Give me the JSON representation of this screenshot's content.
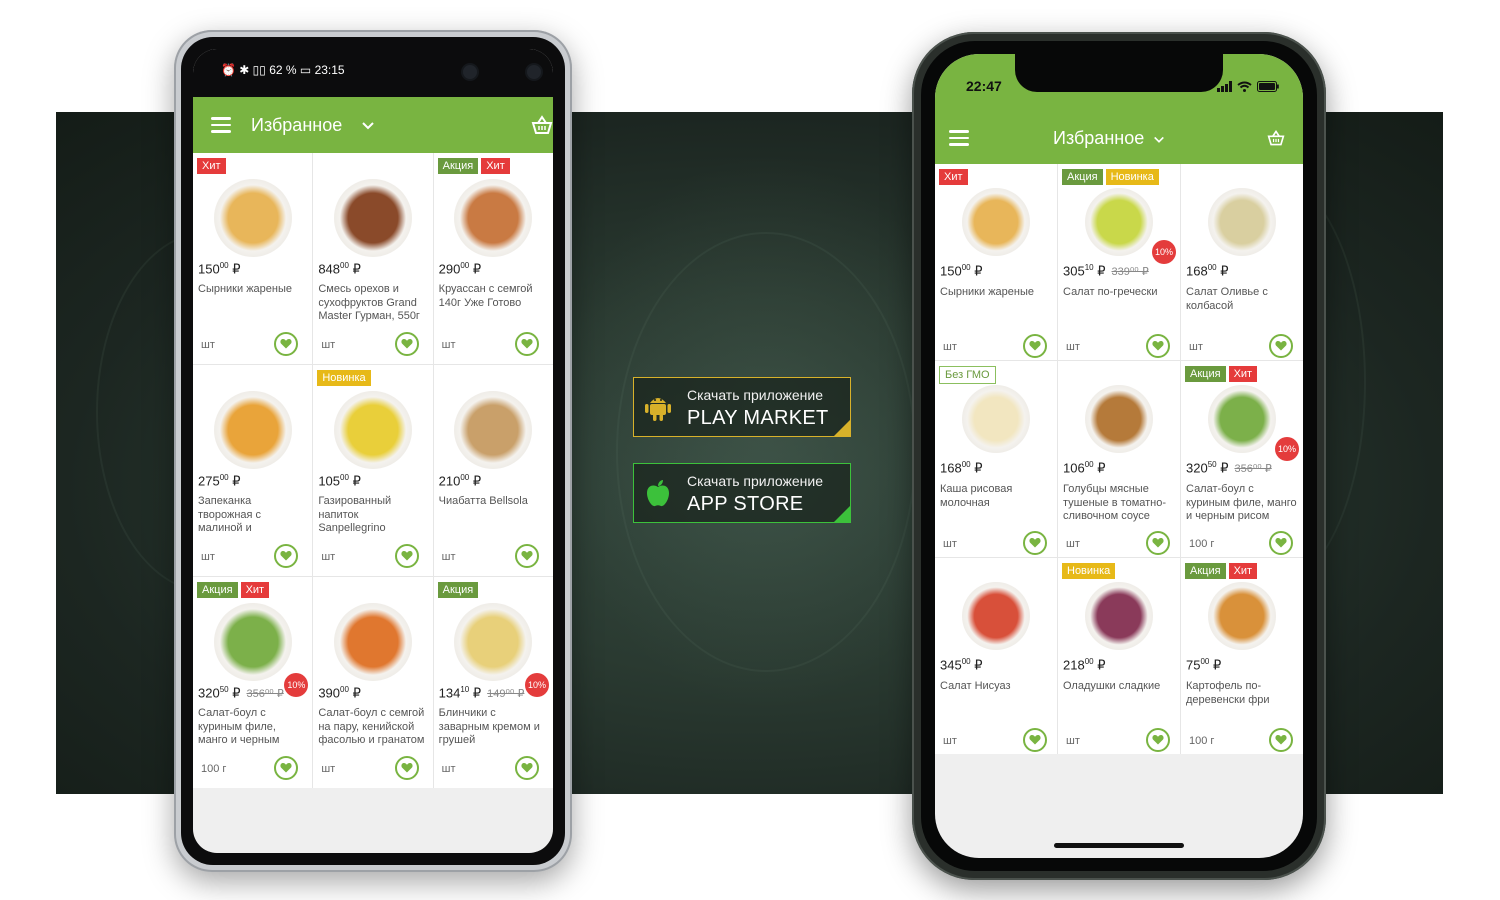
{
  "colors": {
    "brand_green": "#79b441",
    "hit_red": "#e53b3b",
    "promo_green": "#6a9a3e",
    "new_yellow": "#e7b918"
  },
  "store_buttons": {
    "play": {
      "line1": "Скачать приложение",
      "line2": "PLAY MARKET",
      "icon": "android-icon"
    },
    "app": {
      "line1": "Скачать приложение",
      "line2": "APP STORE",
      "icon": "apple-icon"
    }
  },
  "android": {
    "status": {
      "text": "62 % ",
      "time": "23:15"
    },
    "title": "Избранное",
    "products": [
      {
        "badges": [
          {
            "text": "Хит",
            "type": "hit"
          }
        ],
        "price_main": "150",
        "price_cents": "00",
        "currency": "₽",
        "name": "Сырники жареные",
        "unit": "шт",
        "color": "#e8b65a"
      },
      {
        "badges": [],
        "price_main": "848",
        "price_cents": "00",
        "currency": "₽",
        "name": "Смесь орехов и сухофруктов Grand Master Гурман, 550г",
        "unit": "шт",
        "color": "#8a4a2a"
      },
      {
        "badges": [
          {
            "text": "Акция",
            "type": "akc"
          },
          {
            "text": "Хит",
            "type": "hit"
          }
        ],
        "price_main": "290",
        "price_cents": "00",
        "currency": "₽",
        "name": "Круассан с семгой 140г Уже Готово",
        "unit": "шт",
        "color": "#c97a43"
      },
      {
        "badges": [],
        "price_main": "275",
        "price_cents": "00",
        "currency": "₽",
        "name": "Запеканка творожная с малиной и",
        "unit": "шт",
        "color": "#e9a43a"
      },
      {
        "badges": [
          {
            "text": "Новинка",
            "type": "new"
          }
        ],
        "price_main": "105",
        "price_cents": "00",
        "currency": "₽",
        "name": "Газированный напиток Sanpellegrino",
        "unit": "шт",
        "color": "#e9cf3a"
      },
      {
        "badges": [],
        "price_main": "210",
        "price_cents": "00",
        "currency": "₽",
        "name": "Чиабатта Bellsola",
        "unit": "шт",
        "color": "#c9a06a"
      },
      {
        "badges": [
          {
            "text": "Акция",
            "type": "akc"
          },
          {
            "text": "Хит",
            "type": "hit"
          }
        ],
        "price_main": "320",
        "price_cents": "50",
        "old_price": "356⁰⁰ ₽",
        "discount": "10%",
        "currency": "₽",
        "name": "Салат-боул с куриным филе, манго и черным",
        "unit": "100 г",
        "color": "#7cb04a"
      },
      {
        "badges": [],
        "price_main": "390",
        "price_cents": "00",
        "currency": "₽",
        "name": "Салат-боул с семгой на пару, кенийской фасолью и гранатом",
        "unit": "шт",
        "color": "#e0772f"
      },
      {
        "badges": [
          {
            "text": "Акция",
            "type": "akc"
          }
        ],
        "price_main": "134",
        "price_cents": "10",
        "old_price": "149⁰⁰ ₽",
        "discount": "10%",
        "currency": "₽",
        "name": "Блинчики с заварным кремом и грушей",
        "unit": "шт",
        "color": "#e8d07a"
      }
    ]
  },
  "iphone": {
    "status": {
      "time": "22:47"
    },
    "title": "Избранное",
    "products": [
      {
        "badges": [
          {
            "text": "Хит",
            "type": "hit"
          }
        ],
        "price_main": "150",
        "price_cents": "00",
        "currency": "₽",
        "name": "Сырники жареные",
        "unit": "шт",
        "color": "#e8b65a"
      },
      {
        "badges": [
          {
            "text": "Акция",
            "type": "akc"
          },
          {
            "text": "Новинка",
            "type": "new"
          }
        ],
        "price_main": "305",
        "price_cents": "10",
        "old_price": "339⁰⁰ ₽",
        "discount": "10%",
        "currency": "₽",
        "name": "Салат по-гречески",
        "unit": "шт",
        "color": "#c9d84a"
      },
      {
        "badges": [],
        "price_main": "168",
        "price_cents": "00",
        "currency": "₽",
        "name": "Салат Оливье с колбасой",
        "unit": "шт",
        "color": "#d9cfa0"
      },
      {
        "badges": [
          {
            "text": "Без ГМО",
            "type": "gmo"
          }
        ],
        "price_main": "168",
        "price_cents": "00",
        "currency": "₽",
        "name": "Каша рисовая молочная",
        "unit": "шт",
        "color": "#f2e6c0"
      },
      {
        "badges": [],
        "price_main": "106",
        "price_cents": "00",
        "currency": "₽",
        "name": "Голубцы мясные тушеные в томатно-сливочном соусе",
        "unit": "шт",
        "color": "#b57a3a"
      },
      {
        "badges": [
          {
            "text": "Акция",
            "type": "akc"
          },
          {
            "text": "Хит",
            "type": "hit"
          }
        ],
        "price_main": "320",
        "price_cents": "50",
        "old_price": "356⁰⁰ ₽",
        "discount": "10%",
        "currency": "₽",
        "name": "Салат-боул с куриным филе, манго и черным рисом",
        "unit": "100 г",
        "color": "#7cb04a"
      },
      {
        "badges": [],
        "price_main": "345",
        "price_cents": "00",
        "currency": "₽",
        "name": "Салат Нисуаз",
        "unit": "шт",
        "color": "#d8503a"
      },
      {
        "badges": [
          {
            "text": "Новинка",
            "type": "new"
          }
        ],
        "price_main": "218",
        "price_cents": "00",
        "currency": "₽",
        "name": "Оладушки сладкие",
        "unit": "шт",
        "color": "#8a3a5a"
      },
      {
        "badges": [
          {
            "text": "Акция",
            "type": "akc"
          },
          {
            "text": "Хит",
            "type": "hit"
          }
        ],
        "price_main": "75",
        "price_cents": "00",
        "currency": "₽",
        "name": "Картофель по-деревенски фри",
        "unit": "100 г",
        "color": "#d9913a"
      }
    ]
  }
}
